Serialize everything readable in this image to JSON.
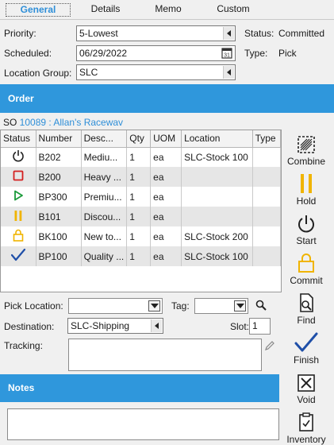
{
  "tabs": [
    "General",
    "Details",
    "Memo",
    "Custom"
  ],
  "form": {
    "priority_label": "Priority:",
    "priority_value": "5-Lowest",
    "scheduled_label": "Scheduled:",
    "scheduled_value": "06/29/2022",
    "location_group_label": "Location Group:",
    "location_group_value": "SLC",
    "status_label": "Status:",
    "status_value": "Committed",
    "type_label": "Type:",
    "type_value": "Pick"
  },
  "order_section": {
    "title": "Order"
  },
  "order_ref": {
    "prefix": "SO ",
    "number": "10089",
    "separator": " : ",
    "customer": "Allan's Racewav"
  },
  "table": {
    "columns": [
      "Status",
      "Number",
      "Desc...",
      "Qty",
      "UOM",
      "Location",
      "Type"
    ],
    "rows": [
      {
        "status_icon": "power-icon",
        "number": "B202",
        "desc": "Mediu...",
        "qty": "1",
        "uom": "ea",
        "location": "SLC-Stock 100",
        "type": ""
      },
      {
        "status_icon": "stop-square-icon",
        "number": "B200",
        "desc": "Heavy ...",
        "qty": "1",
        "uom": "ea",
        "location": "",
        "type": ""
      },
      {
        "status_icon": "play-icon",
        "number": "BP300",
        "desc": "Premiu...",
        "qty": "1",
        "uom": "ea",
        "location": "",
        "type": ""
      },
      {
        "status_icon": "pause-icon",
        "number": "B101",
        "desc": "Discou...",
        "qty": "1",
        "uom": "ea",
        "location": "",
        "type": ""
      },
      {
        "status_icon": "lock-icon",
        "number": "BK100",
        "desc": "New to...",
        "qty": "1",
        "uom": "ea",
        "location": "SLC-Stock 200",
        "type": ""
      },
      {
        "status_icon": "checkmark-icon",
        "number": "BP100",
        "desc": "Quality ...",
        "qty": "1",
        "uom": "ea",
        "location": "SLC-Stock 100",
        "type": ""
      }
    ]
  },
  "bottom_form": {
    "pick_location_label": "Pick Location:",
    "pick_location_value": "",
    "tag_label": "Tag:",
    "tag_value": "",
    "destination_label": "Destination:",
    "destination_value": "SLC-Shipping",
    "slot_label": "Slot:",
    "slot_value": "1",
    "tracking_label": "Tracking:",
    "tracking_value": ""
  },
  "notes_section": {
    "title": "Notes",
    "value": ""
  },
  "toolbar": {
    "combine": "Combine",
    "hold": "Hold",
    "start": "Start",
    "commit": "Commit",
    "find": "Find",
    "finish": "Finish",
    "void": "Void",
    "inventory": "Inventory"
  },
  "colors": {
    "accent": "#2f97dc",
    "link": "#2f8fd8",
    "hold": "#f0b400",
    "start": "#1a9a3a",
    "stop": "#d42020",
    "check": "#1f4fa8"
  }
}
